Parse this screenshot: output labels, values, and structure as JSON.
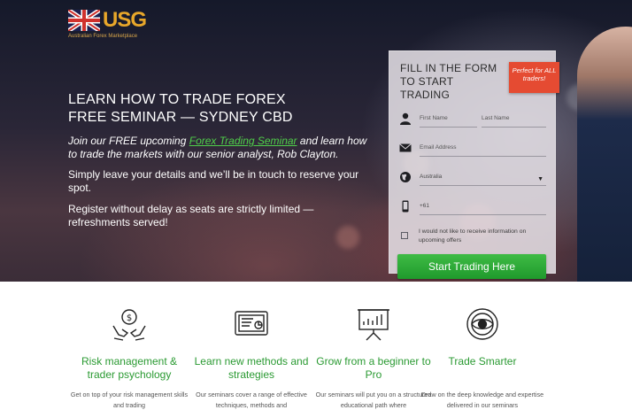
{
  "brand": {
    "name": "USG",
    "tagline": "Australian Forex Marketplace"
  },
  "hero": {
    "title_line1": "LEARN HOW TO TRADE FOREX",
    "title_line2": "FREE SEMINAR — SYDNEY CBD",
    "intro_before": "Join our FREE upcoming ",
    "intro_link": "Forex Trading Seminar",
    "intro_after": " and learn how to trade the markets with our senior analyst, Rob Clayton.",
    "para1": "Simply leave your details and we’ll be in touch to reserve your spot.",
    "para2": "Register without delay as seats are strictly limited — refreshments served!"
  },
  "form": {
    "title": "FILL IN THE FORM TO START TRADING",
    "badge": "Perfect for ALL traders!",
    "first_name_placeholder": "First Name",
    "last_name_placeholder": "Last Name",
    "email_placeholder": "Email Address",
    "country_value": "Australia",
    "phone_prefix": "+61",
    "optout_label": "I would not like to receive information on upcoming offers",
    "submit_label": "Start Trading Here"
  },
  "features": [
    {
      "icon": "money-hands-icon",
      "title": "Risk management & trader psychology",
      "desc": "Get on top of your risk management skills and trading"
    },
    {
      "icon": "tablet-chart-icon",
      "title": "Learn new methods and strategies",
      "desc": "Our seminars cover a range of effective techniques, methods and"
    },
    {
      "icon": "presentation-board-icon",
      "title": "Grow from a beginner to Pro",
      "desc": "Our seminars will put you on a structured educational path where"
    },
    {
      "icon": "target-dollar-icon",
      "title": "Trade Smarter",
      "desc": "Draw on the deep knowledge and expertise delivered in our seminars"
    }
  ],
  "colors": {
    "accent_green": "#2a9a32",
    "cta_green": "#2aa836",
    "badge_red": "#e54b32",
    "logo_gold": "#e8a72a",
    "link_green": "#4fd04a"
  }
}
